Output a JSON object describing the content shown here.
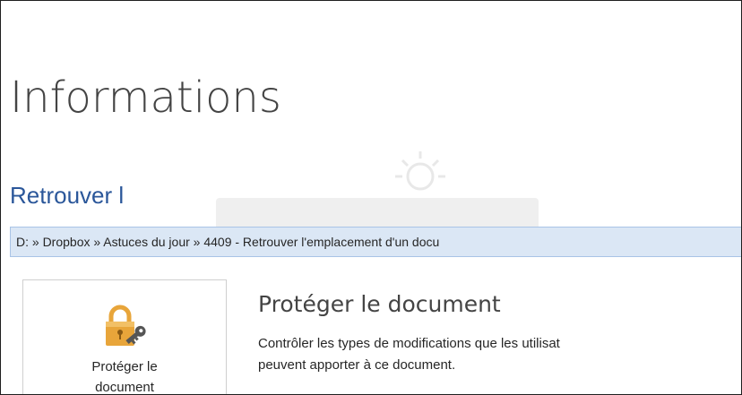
{
  "page": {
    "title": "Informations"
  },
  "section": {
    "title": "Retrouver l"
  },
  "path_bar": {
    "text": "D: » Dropbox » Astuces du jour » 4409 - Retrouver l'emplacement d'un docu"
  },
  "protect": {
    "tile_label_line1": "Protéger le",
    "tile_label_line2": "document",
    "heading": "Protéger le document",
    "description_line1": "Contrôler les types de modifications que les utilisat",
    "description_line2": "peuvent apporter à ce document.",
    "icon": "lock-key-icon"
  },
  "colors": {
    "section_title": "#2b579a",
    "path_bar_bg": "#dbe7f5",
    "path_bar_border": "#a9c4e6",
    "lock_gold": "#e8a53a"
  }
}
